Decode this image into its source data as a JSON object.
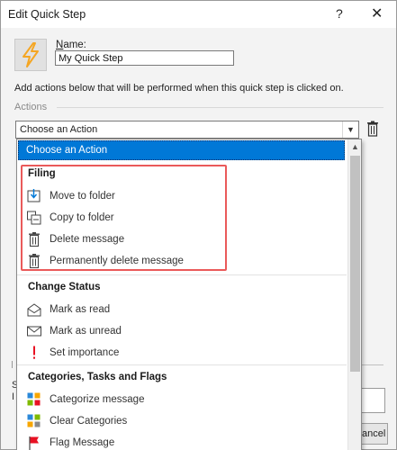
{
  "window": {
    "title": "Edit Quick Step",
    "help": "?",
    "close": "✕"
  },
  "name": {
    "label": "Name:",
    "value": "My Quick Step"
  },
  "instruction": "Add actions below that will be performed when this quick step is clicked on.",
  "actions_label": "Actions",
  "combo": {
    "value": "Choose an Action"
  },
  "dropdown": {
    "selected": "Choose an Action",
    "groups": [
      {
        "header": "Filing",
        "items": [
          "Move to folder",
          "Copy to folder",
          "Delete message",
          "Permanently delete message"
        ]
      },
      {
        "header": "Change Status",
        "items": [
          "Mark as read",
          "Mark as unread",
          "Set importance"
        ]
      },
      {
        "header": "Categories, Tasks and Flags",
        "items": [
          "Categorize message",
          "Clear Categories",
          "Flag Message"
        ]
      }
    ]
  },
  "background": {
    "s_fragment": "S",
    "i_fragment": "I",
    "cancel_fragment": "ancel"
  },
  "colors": {
    "selection": "#0078d7",
    "highlight_border": "#ea5a5a",
    "lightning": "#f5a623",
    "importance": "#e81123"
  }
}
